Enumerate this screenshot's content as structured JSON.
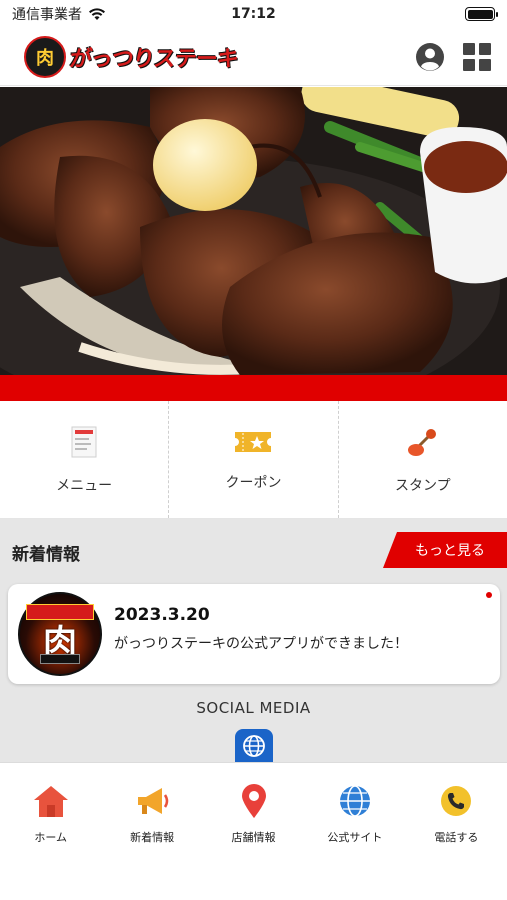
{
  "status_bar": {
    "carrier": "通信事業者",
    "time": "17:12"
  },
  "header": {
    "brand_badge_text": "肉",
    "brand_name": "がっつりステーキ"
  },
  "menu": [
    {
      "label": "メニュー",
      "icon": "menu-book-icon"
    },
    {
      "label": "クーポン",
      "icon": "coupon-ticket-icon"
    },
    {
      "label": "スタンプ",
      "icon": "stamp-icon"
    }
  ],
  "news": {
    "section_title": "新着情報",
    "more_label": "もっと見る",
    "items": [
      {
        "date": "2023.3.20",
        "text": "がっつりステーキの公式アプリができました！",
        "thumb_kanji": "肉"
      }
    ]
  },
  "social": {
    "title": "SOCIAL MEDIA",
    "icon": "globe-icon"
  },
  "tabs": [
    {
      "label": "ホーム",
      "icon": "home-icon"
    },
    {
      "label": "新着情報",
      "icon": "megaphone-icon"
    },
    {
      "label": "店舗情報",
      "icon": "location-pin-icon"
    },
    {
      "label": "公式サイト",
      "icon": "globe-icon"
    },
    {
      "label": "電話する",
      "icon": "phone-icon"
    }
  ],
  "colors": {
    "accent_red": "#e00000",
    "section_gray": "#e6e6e6",
    "coupon_yellow": "#f0b429",
    "globe_blue": "#2f7fd6"
  }
}
